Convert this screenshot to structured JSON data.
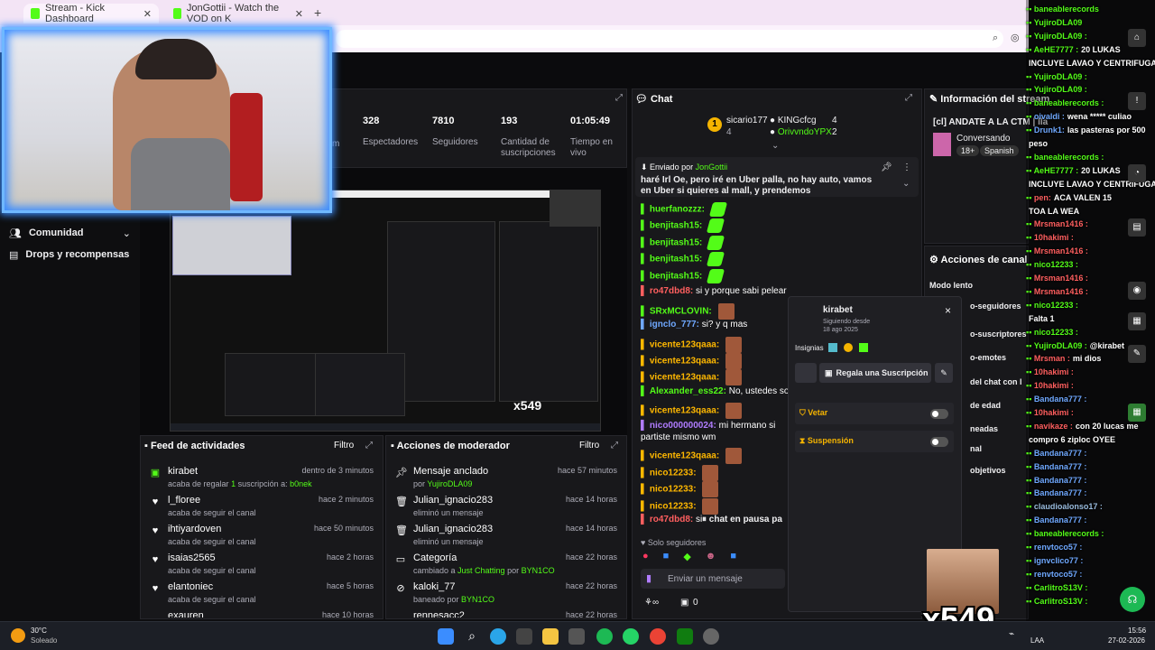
{
  "browser": {
    "tab1_title": "Stream - Kick Dashboard",
    "tab2_title": "JonGottii - Watch the VOD on K",
    "new_tab": "+"
  },
  "sidebar": {
    "community": "Comunidad",
    "drops": "Drops y recompensas"
  },
  "stats": [
    {
      "value": "328",
      "label": "Espectadores"
    },
    {
      "value": "7810",
      "label": "Seguidores"
    },
    {
      "value": "193",
      "label": "Cantidad de suscripciones"
    },
    {
      "value": "01:05:49",
      "label": "Tiempo en vivo"
    }
  ],
  "stats_partial_label": "m",
  "feed": {
    "title": "Feed de actividades",
    "filter": "Filtro",
    "items": [
      {
        "user": "kirabet",
        "time": "dentro de 3 minutos",
        "desc_pre": "acaba de regalar ",
        "desc_num": "1",
        "desc_mid": " suscripción a: ",
        "desc_target": "b0nek"
      },
      {
        "user": "l_floree",
        "time": "hace 2 minutos",
        "desc": "acaba de seguir el canal"
      },
      {
        "user": "ihtiyardoven",
        "time": "hace 50 minutos",
        "desc": "acaba de seguir el canal"
      },
      {
        "user": "isaias2565",
        "time": "hace 2 horas",
        "desc": "acaba de seguir el canal"
      },
      {
        "user": "elantoniec",
        "time": "hace 5 horas",
        "desc": "acaba de seguir el canal"
      },
      {
        "user": "exauren",
        "time": "hace 10 horas",
        "desc": ""
      }
    ]
  },
  "modactions": {
    "title": "Acciones de moderador",
    "filter": "Filtro",
    "items": [
      {
        "title": "Mensaje anclado",
        "pre": "por ",
        "who": "YujiroDLA09",
        "time": "hace 57 minutos"
      },
      {
        "title": "Julian_ignacio283",
        "pre": "eliminó un mensaje",
        "who": "",
        "time": "hace 14 horas"
      },
      {
        "title": "Julian_ignacio283",
        "pre": "eliminó un mensaje",
        "who": "",
        "time": "hace 14 horas"
      },
      {
        "title": "Categoría",
        "pre": "cambiado a ",
        "who": "Just Chatting",
        "mid": " por ",
        "who2": "BYN1CO",
        "time": "hace 22 horas"
      },
      {
        "title": "kaloki_77",
        "pre": "baneado por ",
        "who": "BYN1CO",
        "time": "hace 22 horas"
      },
      {
        "title": "rennesacc2",
        "pre": "",
        "who": "",
        "time": "hace 22 horas"
      }
    ]
  },
  "chat": {
    "title": "Chat",
    "top_user1": "sicario177",
    "top_user1_count": "4",
    "top_user2": "KINGcfcg",
    "top_user2_count": "4",
    "top_user3": "OrivvndoYPX",
    "top_user3_count": "2",
    "pinned_by": "Enviado por",
    "pinned_user": "JonGottii",
    "pinned_text": "haré Irl Oe, pero iré en Uber palla, no hay auto, vamos en Uber si quieres al mall, y prendemos",
    "messages": [
      {
        "user": "huerfanozzz:",
        "text": "",
        "color": "#53fc18"
      },
      {
        "user": "benjitash15:",
        "text": "",
        "color": "#53fc18"
      },
      {
        "user": "benjitash15:",
        "text": "",
        "color": "#53fc18"
      },
      {
        "user": "benjitash15:",
        "text": "",
        "color": "#53fc18"
      },
      {
        "user": "benjitash15:",
        "text": "",
        "color": "#53fc18"
      },
      {
        "user": "ro47dbd8:",
        "text": "si y porque sabi pelear",
        "color": "#ff5f5f"
      },
      {
        "user": "SRxMCLOVIN:",
        "text": "",
        "color": "#53fc18"
      },
      {
        "user": "ignclo_777:",
        "text": "si? y q mas",
        "color": "#6fa8ff"
      },
      {
        "user": "vicente123qaaa:",
        "text": "",
        "color": "#ffb800"
      },
      {
        "user": "vicente123qaaa:",
        "text": "",
        "color": "#ffb800"
      },
      {
        "user": "vicente123qaaa:",
        "text": "",
        "color": "#ffb800"
      },
      {
        "user": "Alexander_ess22:",
        "text": "No, ustedes son herm",
        "color": "#53fc18"
      },
      {
        "user": "vicente123qaaa:",
        "text": "",
        "color": "#ffb800"
      },
      {
        "user": "nico000000024:",
        "text": "mi hermano si partiste mismo wm",
        "color": "#b07cff"
      },
      {
        "user": "vicente123qaaa:",
        "text": "",
        "color": "#ffb800"
      },
      {
        "user": "nico12233:",
        "text": "",
        "color": "#ffb800"
      },
      {
        "user": "nico12233:",
        "text": "",
        "color": "#ffb800"
      },
      {
        "user": "nico12233:",
        "text": "",
        "color": "#ffb800"
      },
      {
        "user": "ro47dbd8:",
        "text": "si y pc",
        "color": "#ff5f5f"
      }
    ],
    "paused": "chat en pausa pa",
    "followers_only": "Solo seguidores",
    "input_placeholder": "Enviar un mensaje",
    "bottom_count": "0"
  },
  "stream_info": {
    "title": "Información del stream",
    "stream_title": "[cl] ANDATE A LA CTM | lla",
    "category": "Conversando",
    "age": "18+",
    "language": "Spanish"
  },
  "channel_actions": {
    "title": "Acciones de canal",
    "items": [
      "Modo lento",
      "o-seguidores",
      "o-suscriptores",
      "o-emotes",
      "del chat con l",
      "de edad",
      "neadas",
      "nal",
      "objetivos"
    ]
  },
  "popup": {
    "user": "kirabet",
    "following_since_label": "Siguiendo desde",
    "following_since": "18 ago 2025",
    "badges_label": "Insignias",
    "gift_button": "Regala una Suscripción",
    "ban": "Vetar",
    "suspend": "Suspensión",
    "close": "×"
  },
  "overlay_chat": [
    {
      "user": "baneablerecords",
      "text": "",
      "cls": "u"
    },
    {
      "user": "YujiroDLA09",
      "text": "",
      "cls": "u"
    },
    {
      "user": "YujiroDLA09 :",
      "text": "",
      "cls": "u"
    },
    {
      "user": "AeHE7777 :",
      "text": "20 LUKAS",
      "cls": "u"
    },
    {
      "user": "",
      "text": "INCLUYE LAVAO Y CENTRIFUGAO",
      "cls": "u w"
    },
    {
      "user": "YujiroDLA09 :",
      "text": "",
      "cls": "u"
    },
    {
      "user": "YujiroDLA09 :",
      "text": "",
      "cls": "u"
    },
    {
      "user": "baneablerecords :",
      "text": "",
      "cls": "u"
    },
    {
      "user": "oivaldi :",
      "text": "wena ***** culiao",
      "cls": "u b"
    },
    {
      "user": "Drunk1:",
      "text": "las pasteras por 500",
      "cls": "u b"
    },
    {
      "user": "",
      "text": "peso",
      "cls": "u w"
    },
    {
      "user": "baneablerecords :",
      "text": "",
      "cls": "u"
    },
    {
      "user": "AeHE7777 :",
      "text": "20 LUKAS",
      "cls": "u"
    },
    {
      "user": "",
      "text": "INCLUYE LAVAO Y CENTRIFUGAO",
      "cls": "u w"
    },
    {
      "user": "pen:",
      "text": "ACA VALEN 15",
      "cls": "u o"
    },
    {
      "user": "",
      "text": "TOA LA WEA",
      "cls": "u w"
    },
    {
      "user": "Mrsman1416 :",
      "text": "",
      "cls": "u o"
    },
    {
      "user": "10hakimi :",
      "text": "",
      "cls": "u o"
    },
    {
      "user": "Mrsman1416 :",
      "text": "",
      "cls": "u o"
    },
    {
      "user": "nico12233 :",
      "text": "",
      "cls": "u"
    },
    {
      "user": "Mrsman1416 :",
      "text": "",
      "cls": "u o"
    },
    {
      "user": "Mrsman1416 :",
      "text": "",
      "cls": "u o"
    },
    {
      "user": "nico12233 :",
      "text": "",
      "cls": "u"
    },
    {
      "user": "",
      "text": "Falta 1",
      "cls": "u o"
    },
    {
      "user": "nico12233 :",
      "text": "",
      "cls": "u"
    },
    {
      "user": "YujiroDLA09 :",
      "text": "@kirabet",
      "cls": "u"
    },
    {
      "user": "Mrsman :",
      "text": "mi dios",
      "cls": "u o"
    },
    {
      "user": "10hakimi :",
      "text": "",
      "cls": "u o"
    },
    {
      "user": "10hakimi :",
      "text": "",
      "cls": "u o"
    },
    {
      "user": "Bandana777 :",
      "text": "",
      "cls": "u b"
    },
    {
      "user": "10hakimi :",
      "text": "",
      "cls": "u o"
    },
    {
      "user": "navikaze :",
      "text": "con 20 lucas me",
      "cls": "u o"
    },
    {
      "user": "",
      "text": "compro 6 ziploc OYEE",
      "cls": "u w"
    },
    {
      "user": "Bandana777 :",
      "text": "",
      "cls": "u b"
    },
    {
      "user": "Bandana777 :",
      "text": "",
      "cls": "u b"
    },
    {
      "user": "Bandana777 :",
      "text": "",
      "cls": "u b"
    },
    {
      "user": "Bandana777 :",
      "text": "",
      "cls": "u b"
    },
    {
      "user": "claudioalonso17 :",
      "text": "",
      "cls": "u gr"
    },
    {
      "user": "Bandana777 :",
      "text": "",
      "cls": "u b"
    },
    {
      "user": "baneablerecords :",
      "text": "",
      "cls": "u"
    },
    {
      "user": "renvtoco57 :",
      "text": "",
      "cls": "u b"
    },
    {
      "user": "ignvclico77 :",
      "text": "",
      "cls": "u b"
    },
    {
      "user": "renvtoco57 :",
      "text": "",
      "cls": "u b"
    },
    {
      "user": "CarlitroS13V :",
      "text": "",
      "cls": "u"
    },
    {
      "user": "CarlitroS13V :",
      "text": "",
      "cls": "u"
    }
  ],
  "taskbar": {
    "temp": "30°C",
    "weather": "Soleado",
    "lang": "LAA",
    "time": "15:56",
    "date": "27-02-2026"
  },
  "overlay_x549": "x549"
}
